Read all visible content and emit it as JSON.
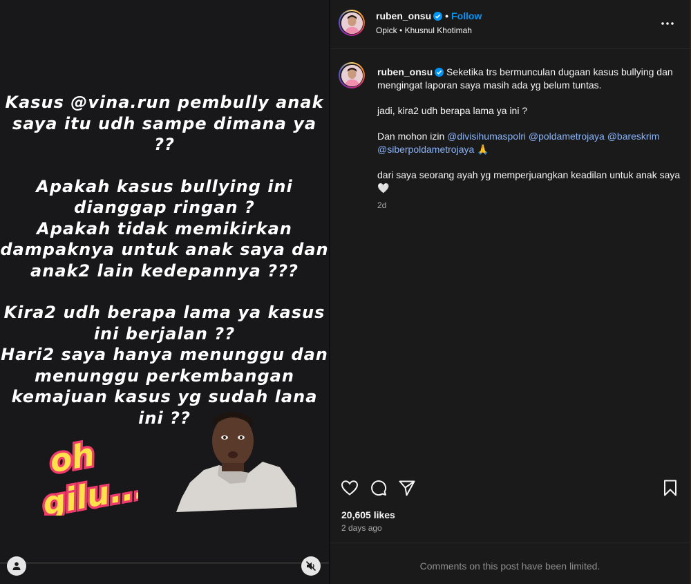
{
  "media": {
    "story_paragraphs": [
      "Kasus @vina.run pembully anak\nsaya itu udh sampe dimana ya ??",
      "Apakah kasus bullying ini\ndianggap ringan ?\nApakah tidak memikirkan\ndampaknya untuk anak saya dan\nanak2 lain kedepannya ???",
      "Kira2 udh berapa lama ya kasus\nini berjalan ??\nHari2 saya hanya menunggu dan\nmenunggu perkembangan\nkemajuan kasus yg sudah lana\nini ??"
    ],
    "sticker_text": "oh gilu...",
    "user_tag_icon": "person-icon",
    "mute_icon": "speaker-muted-icon"
  },
  "header": {
    "username": "ruben_onsu",
    "follow_label": "Follow",
    "dot": "•",
    "audio_artist": "Opick",
    "audio_sep": "•",
    "audio_title": "Khusnul Khotimah",
    "more_icon": "more-horizontal-icon"
  },
  "caption": {
    "username": "ruben_onsu",
    "line1": "Seketika trs bermunculan dugaan kasus bullying dan mengingat laporan saya masih ada yg belum tuntas.",
    "line2": "jadi, kira2 udh berapa lama ya ini ?",
    "line3_prefix": "Dan mohon izin",
    "mentions": [
      "@divisihumaspolri",
      "@poldametrojaya",
      "@bareskrim",
      "@siberpoldametrojaya"
    ],
    "line3_emoji": "🙏",
    "line4": "dari saya seorang ayah yg memperjuangkan keadilan untuk anak saya",
    "line4_emoji": "🤍",
    "time": "2d"
  },
  "actions": {
    "like_icon": "heart-icon",
    "comment_icon": "comment-icon",
    "share_icon": "share-icon",
    "save_icon": "bookmark-icon"
  },
  "likes_text": "20,605 likes",
  "posted_ago": "2 days ago",
  "comments_notice": "Comments on this post have been limited.",
  "colors": {
    "link": "#0095f6",
    "mention": "#8ab4f8",
    "background": "#1a1a1b"
  }
}
